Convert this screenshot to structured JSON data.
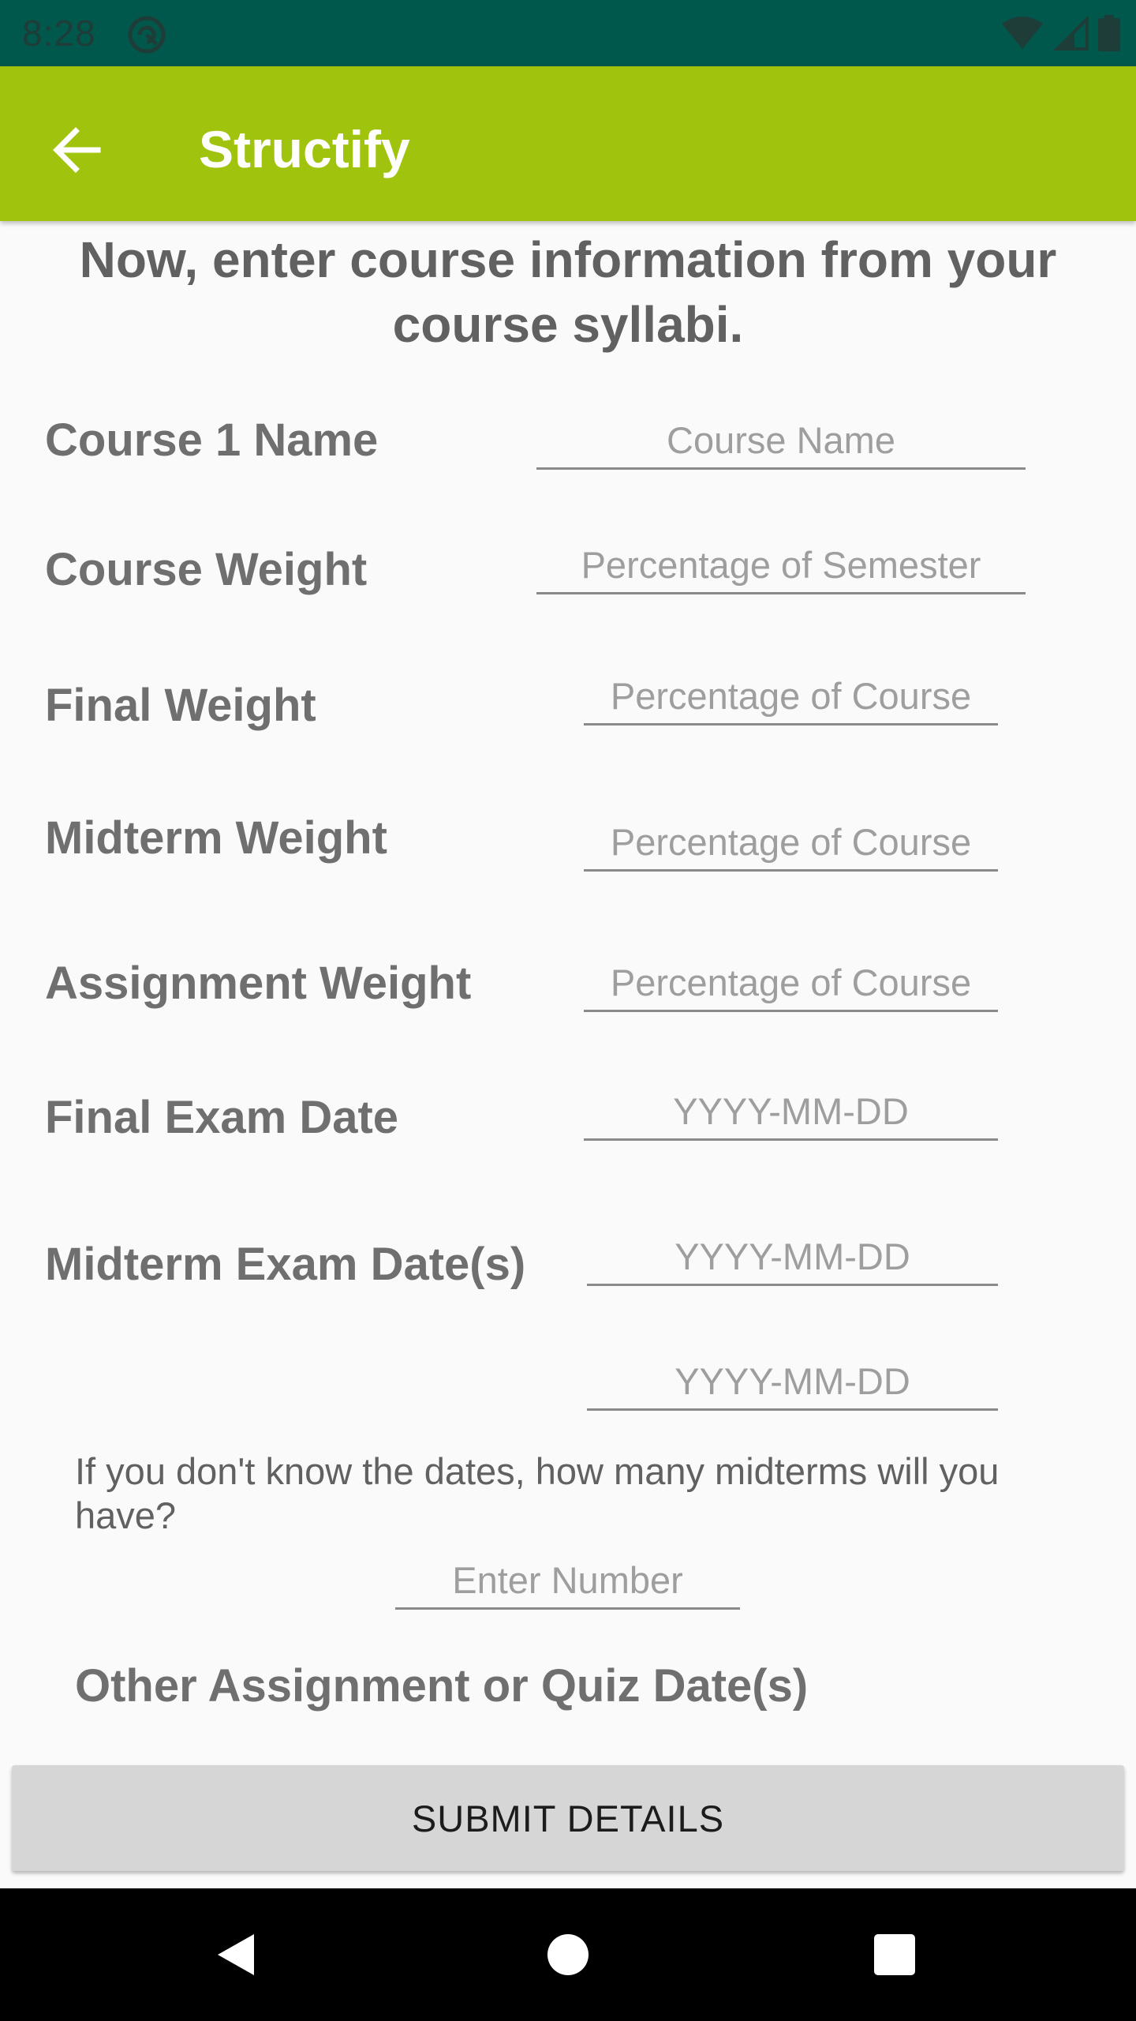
{
  "status_bar": {
    "time": "8:28",
    "icons": [
      "notification-icon",
      "wifi-icon",
      "signal-icon",
      "battery-icon"
    ]
  },
  "app_bar": {
    "title": "Structify",
    "back_icon": "arrow-back-icon",
    "color": "#a0c30e"
  },
  "intro": "Now, enter course information from your course syllabi.",
  "form": {
    "course_name": {
      "label": "Course 1 Name",
      "placeholder": "Course Name"
    },
    "course_weight": {
      "label": "Course Weight",
      "placeholder": "Percentage of Semester"
    },
    "final_weight": {
      "label": "Final Weight",
      "placeholder": "Percentage of Course"
    },
    "midterm_weight": {
      "label": "Midterm Weight",
      "placeholder": "Percentage of Course"
    },
    "assignment_weight": {
      "label": "Assignment Weight",
      "placeholder": "Percentage of Course"
    },
    "final_exam_date": {
      "label": "Final Exam Date",
      "placeholder": "YYYY-MM-DD"
    },
    "midterm_exam_dates": {
      "label": "Midterm Exam Date(s)",
      "placeholders": [
        "YYYY-MM-DD",
        "YYYY-MM-DD"
      ]
    },
    "midterm_count": {
      "question": "If you don't know the dates, how many midterms will you have?",
      "placeholder": "Enter Number"
    },
    "other_dates_label": "Other Assignment or Quiz Date(s)"
  },
  "submit_label": "SUBMIT DETAILS",
  "nav_bar": {
    "icons": [
      "back-triangle-icon",
      "home-circle-icon",
      "recents-square-icon"
    ]
  }
}
